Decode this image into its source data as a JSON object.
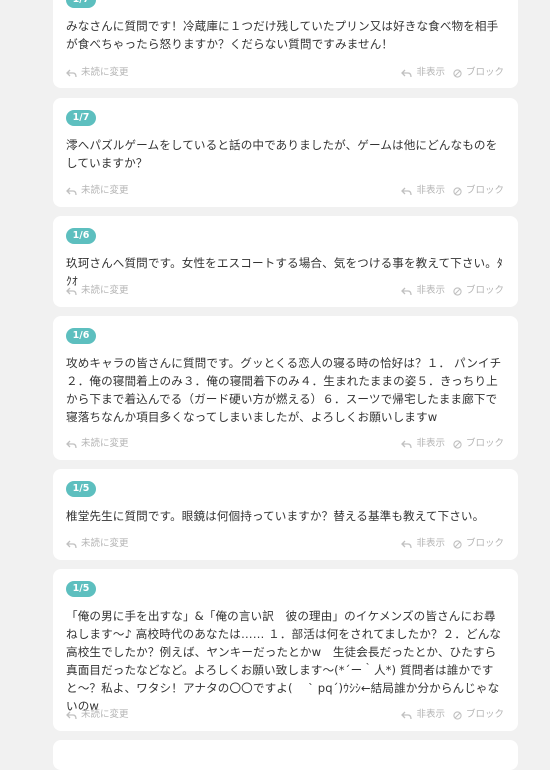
{
  "labels": {
    "unread": "未読に変更",
    "hide": "非表示",
    "block": "ブロック"
  },
  "posts": [
    {
      "date": "1/7",
      "text": "みなさんに質問です！冷蔵庫に１つだけ残していたプリン又は好きな食べ物を相手が食べちゃったら怒りますか？くだらない質問ですみません！"
    },
    {
      "date": "1/7",
      "text": "澪へパズルゲームをしていると話の中でありましたが、ゲームは他にどんなものをしていますか？"
    },
    {
      "date": "1/6",
      "text": "玖珂さんへ質問です。女性をエスコートする場合、気をつける事を教えて下さい。ﾀｸｵ"
    },
    {
      "date": "1/6",
      "text": "攻めキャラの皆さんに質問です。グッとくる恋人の寝る時の恰好は？１． パンイチ　２．俺の寝間着上のみ３．俺の寝間着下のみ４．生まれたままの姿５．きっちり上から下まで着込んでる（ガード硬い方が燃える）６．スーツで帰宅したまま廊下で寝落ちなんか項目多くなってしまいましたが、よろしくお願いしますw"
    },
    {
      "date": "1/5",
      "text": "椎堂先生に質問です。眼鏡は何個持っていますか？替える基準も教えて下さい。"
    },
    {
      "date": "1/5",
      "text": "「俺の男に手を出すな」&「俺の言い訳　彼の理由」のイケメンズの皆さんにお尋ねします〜♪ 高校時代のあなたは…… １．部活は何をされてましたか？２．どんな高校生でしたか？例えば、ヤンキーだったとかw　生徒会長だったとか、ひたすら真面目だったなどなど。よろしくお願い致します〜(*´ー｀人*) 質問者は誰かですと〜？私よ、ワタシ！アナタの〇〇ですよ(　 ` pq´)ｳｼｼ←結局誰か分からんじゃないのw"
    }
  ]
}
